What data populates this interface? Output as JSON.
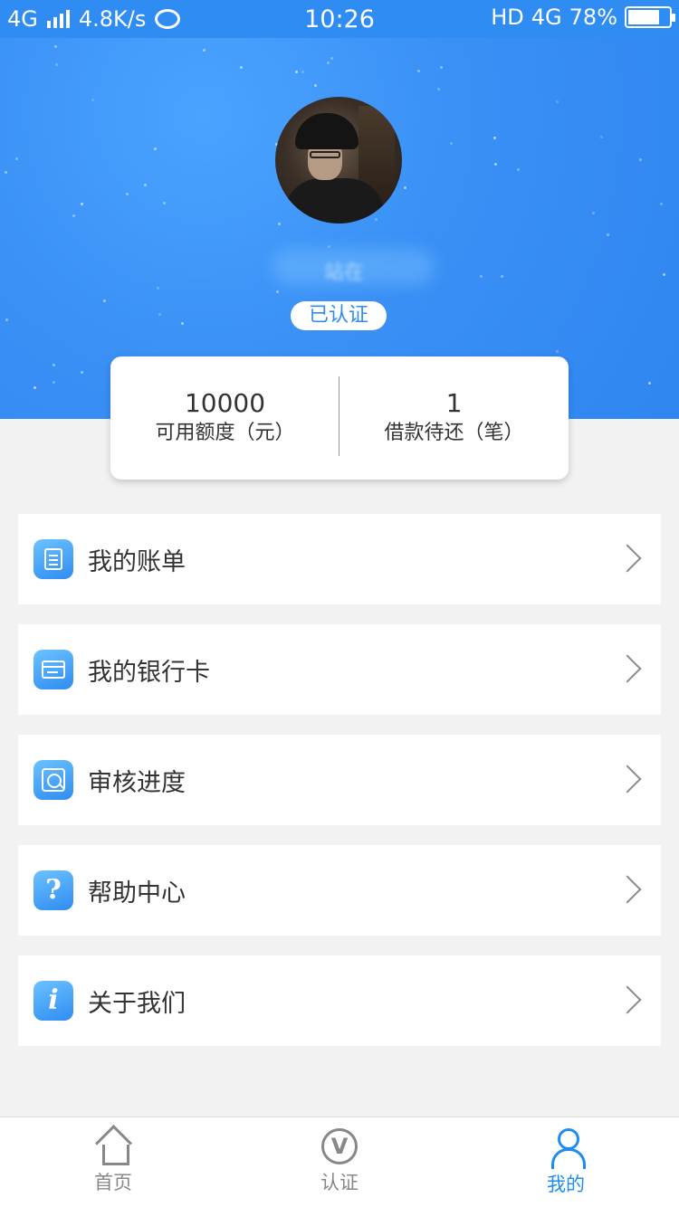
{
  "status_bar": {
    "network": "4G",
    "speed": "4.8K/s",
    "time": "10:26",
    "hd": "HD",
    "network_right": "4G",
    "battery": "78%",
    "battery_level": 0.78,
    "icons": [
      "signal-icon",
      "weibo-icon",
      "battery-icon"
    ]
  },
  "profile": {
    "username": "站在",
    "verified_badge": "已认证"
  },
  "stats": [
    {
      "value": "10000",
      "label": "可用额度（元）"
    },
    {
      "value": "1",
      "label": "借款待还（笔）"
    }
  ],
  "menu": [
    {
      "label": "我的账单",
      "icon": "bill-icon"
    },
    {
      "label": "我的银行卡",
      "icon": "bank-card-icon"
    },
    {
      "label": "审核进度",
      "icon": "review-progress-icon"
    },
    {
      "label": "帮助中心",
      "icon": "help-icon"
    },
    {
      "label": "关于我们",
      "icon": "info-icon"
    }
  ],
  "tabbar": [
    {
      "label": "首页",
      "icon": "home-icon",
      "active": false
    },
    {
      "label": "认证",
      "icon": "verify-icon",
      "active": false
    },
    {
      "label": "我的",
      "icon": "profile-icon",
      "active": true
    }
  ],
  "colors": {
    "primary": "#2f8cf2",
    "active_tab": "#1f8df0",
    "background": "#f2f2f2"
  }
}
